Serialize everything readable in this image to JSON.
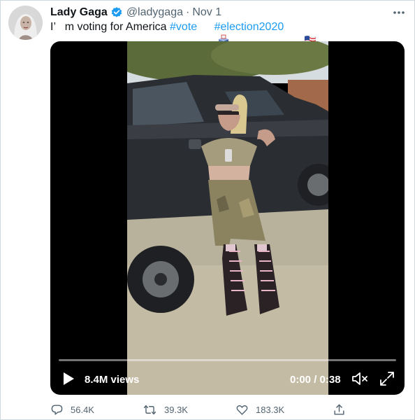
{
  "author": {
    "name": "Lady Gaga",
    "handle": "@ladygaga",
    "separator": "·",
    "date": "Nov 1",
    "verified": true
  },
  "tweet": {
    "text_before": "I’   m voting for America ",
    "hashtag_vote": "#vote",
    "hashtag_election": "#election2020"
  },
  "video": {
    "views": "8.4M views",
    "time": "0:00 / 0:38",
    "progress": 0
  },
  "actions": {
    "replies": "56.4K",
    "retweets": "39.3K",
    "likes": "183.3K"
  },
  "icons": {
    "verified": "verified-badge-icon",
    "more": "more-icon",
    "play": "play-icon",
    "mute": "mute-icon",
    "expand": "expand-icon",
    "reply": "reply-icon",
    "retweet": "retweet-icon",
    "like": "heart-icon",
    "share": "share-icon"
  },
  "colors": {
    "link": "#1d9bf0",
    "secondary_text": "#536471",
    "verified": "#1d9bf0",
    "border": "#cfd9de"
  }
}
